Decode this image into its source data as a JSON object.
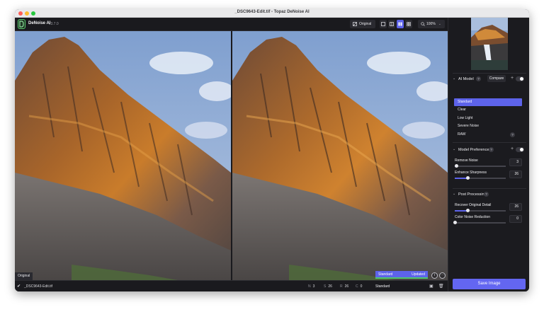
{
  "window": {
    "title": "_DSC9643-Edit.tif - Topaz DeNoise AI"
  },
  "app": {
    "name": "DeNoise AI",
    "version": "v3.7.0"
  },
  "toolbar": {
    "original_label": "Original",
    "zoom_value": "100%"
  },
  "preview": {
    "left_label": "Original",
    "right_status_model": "Standard",
    "right_status_state": "Updated"
  },
  "bottombar": {
    "file_name": "_DSC9643-Edit.tif",
    "stats": [
      {
        "key": "N",
        "value": "3"
      },
      {
        "key": "S",
        "value": "26"
      },
      {
        "key": "R",
        "value": "26"
      },
      {
        "key": "C",
        "value": "0"
      }
    ],
    "model": "Standard"
  },
  "sidebar": {
    "ai_model": {
      "title": "AI Model",
      "compare_label": "Compare",
      "models": [
        "Standard",
        "Clear",
        "Low Light",
        "Severe Noise",
        "RAW"
      ],
      "selected": "Standard"
    },
    "model_preferences": {
      "title": "Model Preferences",
      "remove_noise": {
        "label": "Remove Noise",
        "value": "3",
        "fraction": 0.03
      },
      "enhance_sharpness": {
        "label": "Enhance Sharpness",
        "value": "26",
        "fraction": 0.26
      }
    },
    "post_processing": {
      "title": "Post Processing",
      "recover_detail": {
        "label": "Recover Original Detail",
        "value": "26",
        "fraction": 0.26
      },
      "color_noise": {
        "label": "Color Noise Reduction",
        "value": "0",
        "fraction": 0.0
      }
    },
    "save_label": "Save Image"
  },
  "colors": {
    "accent": "#5d63ea",
    "success": "#4fc86a",
    "app_bg": "#1d1d21"
  }
}
